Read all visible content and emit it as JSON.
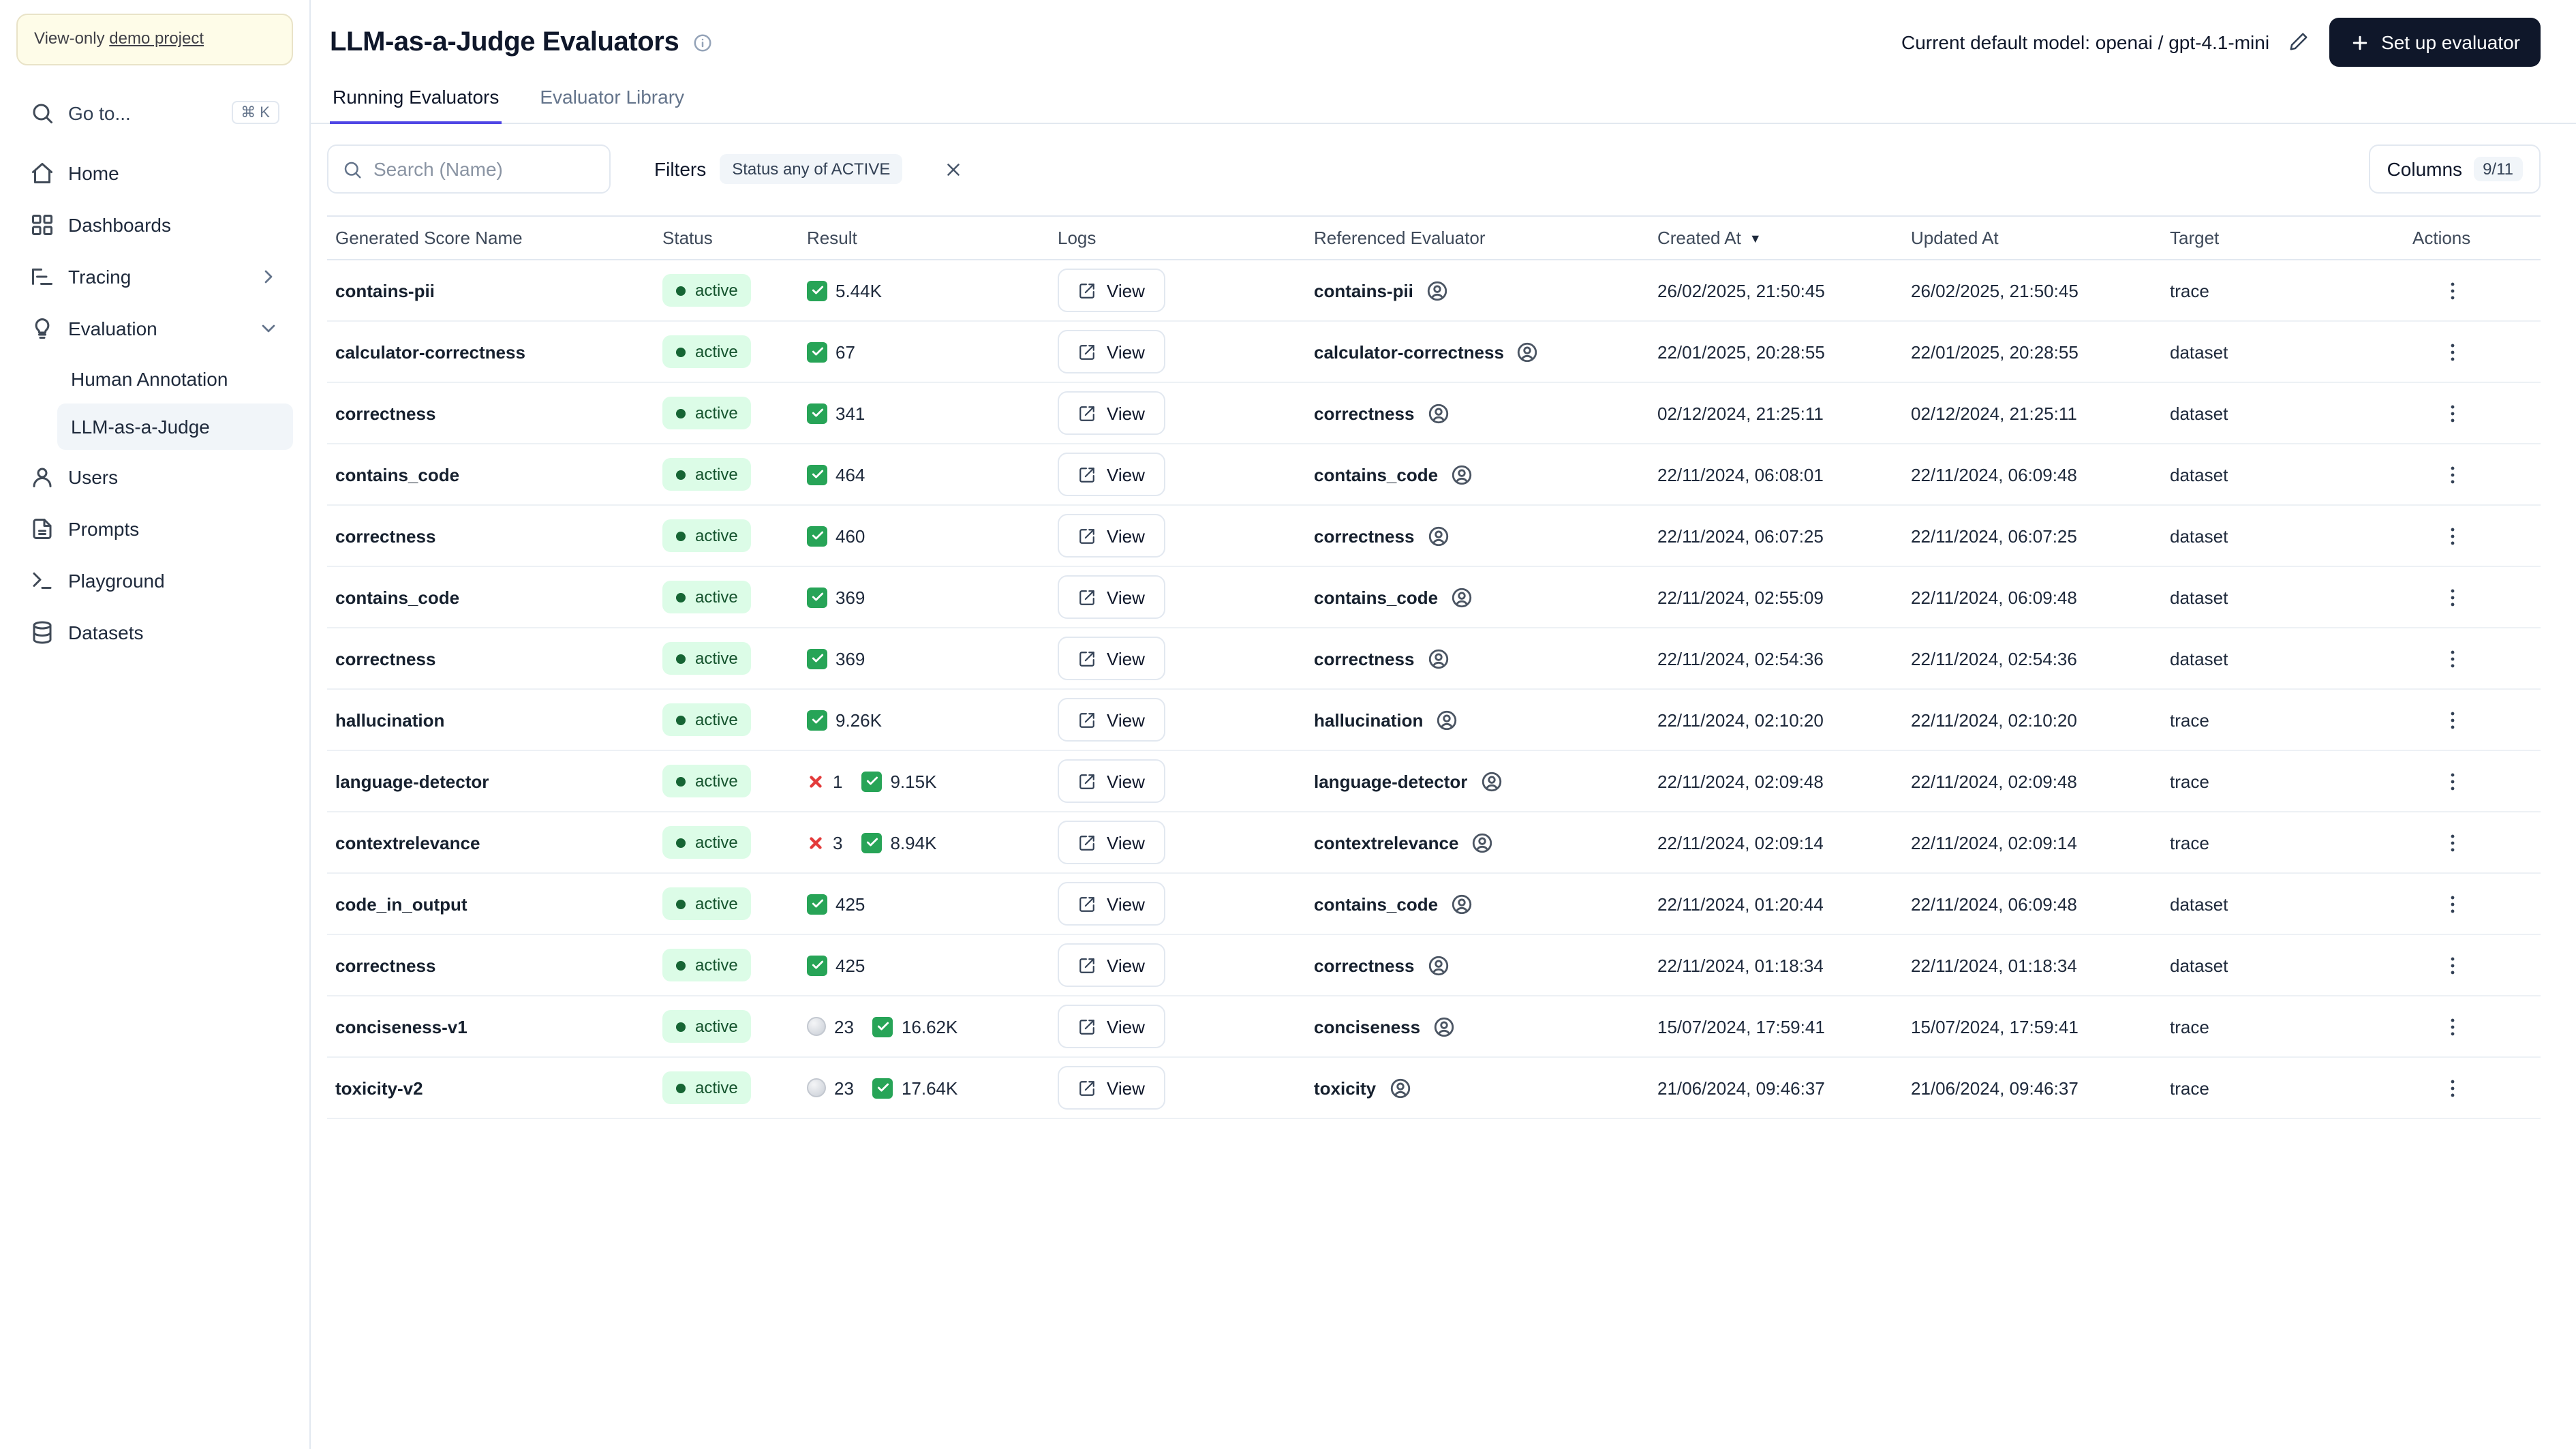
{
  "colors": {
    "accent": "#4f46e5",
    "success": "#27a457",
    "error": "#e33b3b",
    "active_badge_bg": "#dcfce7",
    "active_badge_text": "#14532d",
    "primary_button_bg": "#0f172a"
  },
  "sidebar": {
    "banner": {
      "prefix": "View-only ",
      "link": "demo project"
    },
    "goto": {
      "label": "Go to...",
      "shortcut": "⌘ K",
      "icon": "search"
    },
    "items": [
      {
        "label": "Home",
        "icon": "home"
      },
      {
        "label": "Dashboards",
        "icon": "grid"
      },
      {
        "label": "Tracing",
        "icon": "list-tree",
        "chevron": "right"
      },
      {
        "label": "Evaluation",
        "icon": "lightbulb",
        "chevron": "down",
        "children": [
          {
            "label": "Human Annotation",
            "active": false
          },
          {
            "label": "LLM-as-a-Judge",
            "active": true
          }
        ]
      },
      {
        "label": "Users",
        "icon": "users"
      },
      {
        "label": "Prompts",
        "icon": "file-text"
      },
      {
        "label": "Playground",
        "icon": "terminal"
      },
      {
        "label": "Datasets",
        "icon": "database"
      }
    ]
  },
  "header": {
    "title": "LLM-as-a-Judge Evaluators",
    "default_model_label": "Current default model: openai / gpt-4.1-mini",
    "setup_button": "Set up evaluator"
  },
  "tabs": [
    {
      "label": "Running Evaluators",
      "active": true
    },
    {
      "label": "Evaluator Library",
      "active": false
    }
  ],
  "toolbar": {
    "search_placeholder": "Search (Name)",
    "filters_label": "Filters",
    "filter_chip": "Status any of ACTIVE",
    "columns_label": "Columns",
    "columns_count": "9/11"
  },
  "table": {
    "columns": [
      "Generated Score Name",
      "Status",
      "Result",
      "Logs",
      "Referenced Evaluator",
      "Created At",
      "Updated At",
      "Target",
      "Actions"
    ],
    "sort_column": "Created At",
    "sort_direction": "desc",
    "rows": [
      {
        "name": "contains-pii",
        "status": "active",
        "results": [
          {
            "type": "success",
            "count": "5.44K"
          }
        ],
        "logs": "View",
        "evaluator": "contains-pii",
        "created": "26/02/2025, 21:50:45",
        "updated": "26/02/2025, 21:50:45",
        "target": "trace"
      },
      {
        "name": "calculator-correctness",
        "status": "active",
        "results": [
          {
            "type": "success",
            "count": "67"
          }
        ],
        "logs": "View",
        "evaluator": "calculator-correctness",
        "created": "22/01/2025, 20:28:55",
        "updated": "22/01/2025, 20:28:55",
        "target": "dataset"
      },
      {
        "name": "correctness",
        "status": "active",
        "results": [
          {
            "type": "success",
            "count": "341"
          }
        ],
        "logs": "View",
        "evaluator": "correctness",
        "created": "02/12/2024, 21:25:11",
        "updated": "02/12/2024, 21:25:11",
        "target": "dataset"
      },
      {
        "name": "contains_code",
        "status": "active",
        "results": [
          {
            "type": "success",
            "count": "464"
          }
        ],
        "logs": "View",
        "evaluator": "contains_code",
        "created": "22/11/2024, 06:08:01",
        "updated": "22/11/2024, 06:09:48",
        "target": "dataset"
      },
      {
        "name": "correctness",
        "status": "active",
        "results": [
          {
            "type": "success",
            "count": "460"
          }
        ],
        "logs": "View",
        "evaluator": "correctness",
        "created": "22/11/2024, 06:07:25",
        "updated": "22/11/2024, 06:07:25",
        "target": "dataset"
      },
      {
        "name": "contains_code",
        "status": "active",
        "results": [
          {
            "type": "success",
            "count": "369"
          }
        ],
        "logs": "View",
        "evaluator": "contains_code",
        "created": "22/11/2024, 02:55:09",
        "updated": "22/11/2024, 06:09:48",
        "target": "dataset"
      },
      {
        "name": "correctness",
        "status": "active",
        "results": [
          {
            "type": "success",
            "count": "369"
          }
        ],
        "logs": "View",
        "evaluator": "correctness",
        "created": "22/11/2024, 02:54:36",
        "updated": "22/11/2024, 02:54:36",
        "target": "dataset"
      },
      {
        "name": "hallucination",
        "status": "active",
        "results": [
          {
            "type": "success",
            "count": "9.26K"
          }
        ],
        "logs": "View",
        "evaluator": "hallucination",
        "created": "22/11/2024, 02:10:20",
        "updated": "22/11/2024, 02:10:20",
        "target": "trace"
      },
      {
        "name": "language-detector",
        "status": "active",
        "results": [
          {
            "type": "error",
            "count": "1"
          },
          {
            "type": "success",
            "count": "9.15K"
          }
        ],
        "logs": "View",
        "evaluator": "language-detector",
        "created": "22/11/2024, 02:09:48",
        "updated": "22/11/2024, 02:09:48",
        "target": "trace"
      },
      {
        "name": "contextrelevance",
        "status": "active",
        "results": [
          {
            "type": "error",
            "count": "3"
          },
          {
            "type": "success",
            "count": "8.94K"
          }
        ],
        "logs": "View",
        "evaluator": "contextrelevance",
        "created": "22/11/2024, 02:09:14",
        "updated": "22/11/2024, 02:09:14",
        "target": "trace"
      },
      {
        "name": "code_in_output",
        "status": "active",
        "results": [
          {
            "type": "success",
            "count": "425"
          }
        ],
        "logs": "View",
        "evaluator": "contains_code",
        "created": "22/11/2024, 01:20:44",
        "updated": "22/11/2024, 06:09:48",
        "target": "dataset"
      },
      {
        "name": "correctness",
        "status": "active",
        "results": [
          {
            "type": "success",
            "count": "425"
          }
        ],
        "logs": "View",
        "evaluator": "correctness",
        "created": "22/11/2024, 01:18:34",
        "updated": "22/11/2024, 01:18:34",
        "target": "dataset"
      },
      {
        "name": "conciseness-v1",
        "status": "active",
        "results": [
          {
            "type": "pending",
            "count": "23"
          },
          {
            "type": "success",
            "count": "16.62K"
          }
        ],
        "logs": "View",
        "evaluator": "conciseness",
        "created": "15/07/2024, 17:59:41",
        "updated": "15/07/2024, 17:59:41",
        "target": "trace"
      },
      {
        "name": "toxicity-v2",
        "status": "active",
        "results": [
          {
            "type": "pending",
            "count": "23"
          },
          {
            "type": "success",
            "count": "17.64K"
          }
        ],
        "logs": "View",
        "evaluator": "toxicity",
        "created": "21/06/2024, 09:46:37",
        "updated": "21/06/2024, 09:46:37",
        "target": "trace"
      }
    ]
  }
}
